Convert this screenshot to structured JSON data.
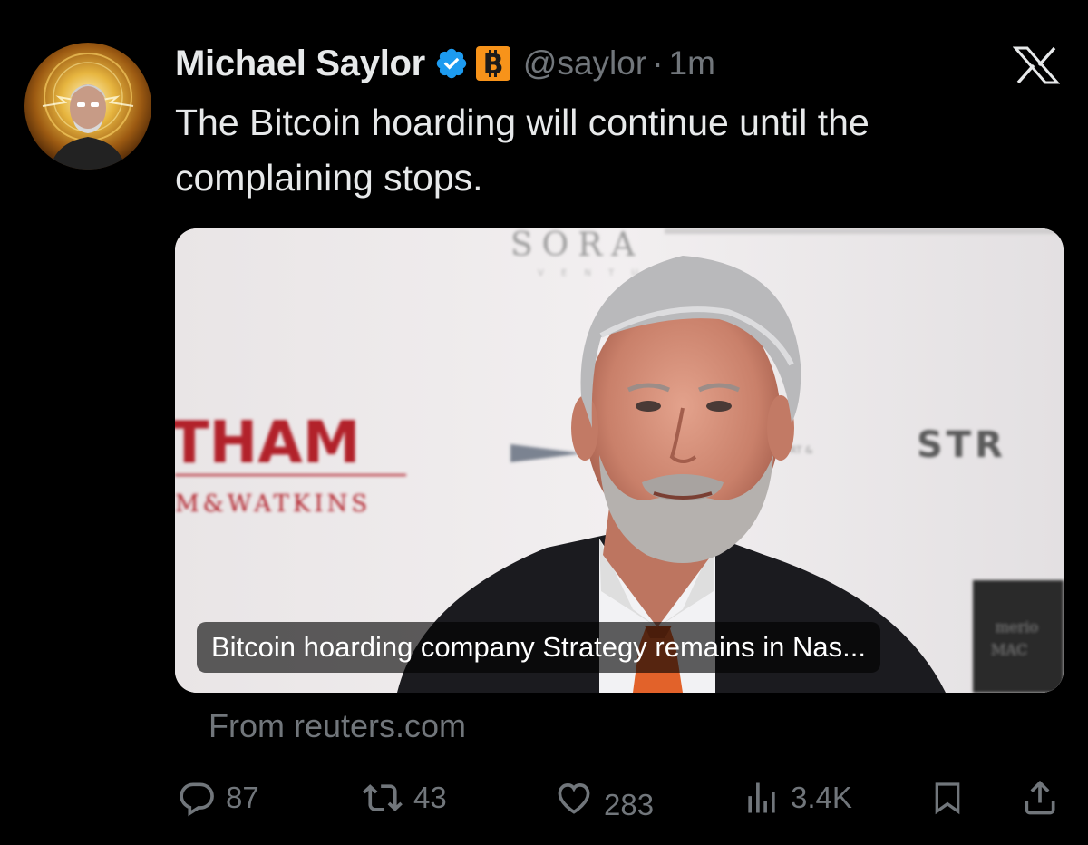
{
  "author": {
    "display_name": "Michael Saylor",
    "handle": "@saylor",
    "separator": "·",
    "time_ago": "1m",
    "badge_colors": {
      "verified": "#1d9bf0",
      "bitcoin": "#f7931a"
    }
  },
  "tweet": {
    "text": "The Bitcoin hoarding will continue until the complaining stops."
  },
  "card": {
    "headline": "Bitcoin hoarding company Strategy remains in Nas...",
    "source": "From reuters.com",
    "backdrop_texts": [
      "SORA",
      "THAM",
      "M&WATKINS",
      "STR"
    ]
  },
  "actions": {
    "replies": "87",
    "reposts": "43",
    "likes": "283",
    "views": "3.4K"
  },
  "icons": [
    "avatar",
    "verified-icon",
    "bitcoin-badge-icon",
    "x-logo-icon",
    "reply-icon",
    "repost-icon",
    "like-icon",
    "views-icon",
    "bookmark-icon",
    "share-icon"
  ]
}
